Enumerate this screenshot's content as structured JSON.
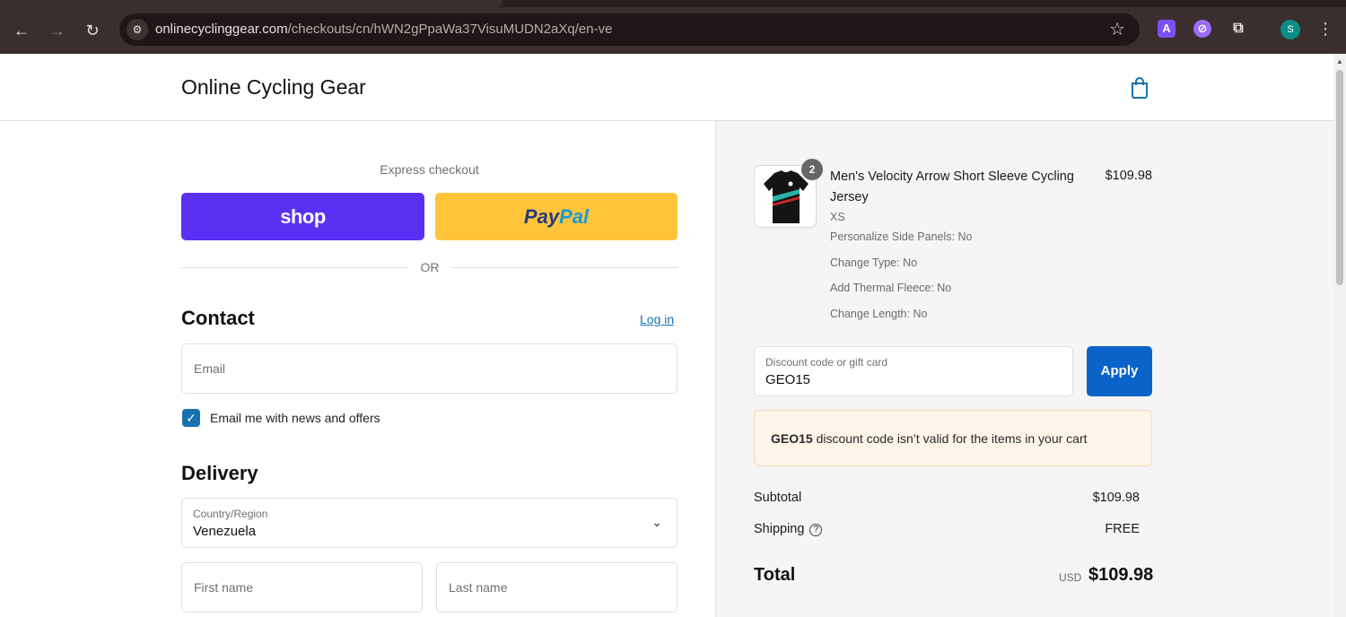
{
  "browser": {
    "url_host": "onlinecyclinggear.com",
    "url_path": "/checkouts/cn/hWN2gPpaWa37VisuMUDN2aXq/en-ve",
    "avatar_letter": "S",
    "ext_a_letter": "A"
  },
  "header": {
    "brand": "Online Cycling Gear"
  },
  "express": {
    "label": "Express checkout",
    "shop_label": "shop",
    "paypal_pay": "Pay",
    "paypal_pal": "Pal",
    "or_label": "OR"
  },
  "contact": {
    "heading": "Contact",
    "login_label": "Log in",
    "email_placeholder": "Email",
    "newsletter_label": "Email me with news and offers",
    "newsletter_checked": true
  },
  "delivery": {
    "heading": "Delivery",
    "country_label": "Country/Region",
    "country_value": "Venezuela",
    "first_name_placeholder": "First name",
    "last_name_placeholder": "Last name"
  },
  "summary": {
    "product": {
      "quantity": "2",
      "name": "Men's Velocity Arrow Short Sleeve Cycling Jersey",
      "price": "$109.98",
      "options": [
        "XS",
        "Personalize Side Panels: No",
        "Change Type: No",
        "Add Thermal Fleece: No",
        "Change Length: No"
      ]
    },
    "discount": {
      "label": "Discount code or gift card",
      "value": "GEO15",
      "apply_label": "Apply",
      "error_code": "GEO15",
      "error_message": "discount code isn’t valid for the items in your cart"
    },
    "subtotal_label": "Subtotal",
    "subtotal_value": "$109.98",
    "shipping_label": "Shipping",
    "shipping_value": "FREE",
    "total_label": "Total",
    "total_currency": "USD",
    "total_value": "$109.98"
  }
}
